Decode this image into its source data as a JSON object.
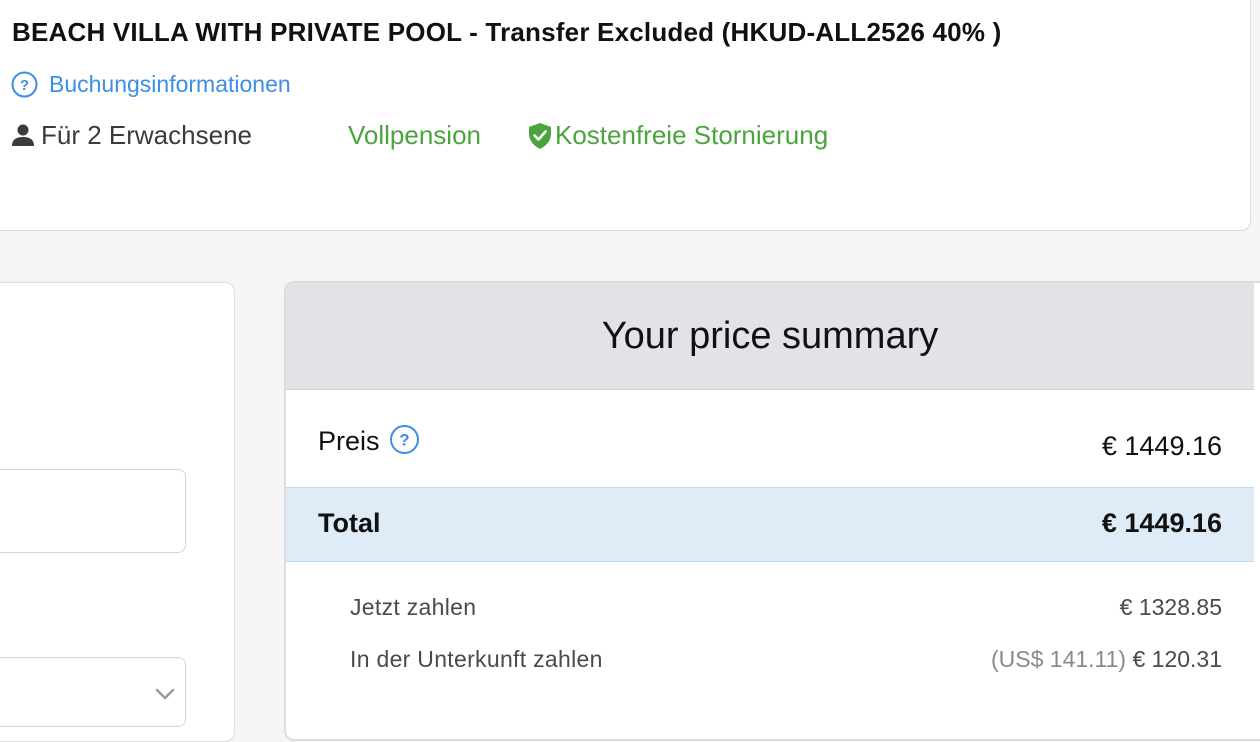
{
  "room": {
    "title": "BEACH VILLA WITH PRIVATE POOL - Transfer Excluded (HKUD-ALL2526 40% )",
    "booking_info_label": "Buchungsinformationen",
    "booking_info_icon": "question-circle-icon",
    "guests_icon": "person-icon",
    "guests": "Für 2 Erwachsene",
    "board": "Vollpension",
    "cancellation_icon": "shield-check-icon",
    "cancellation": "Kostenfreie Stornierung"
  },
  "price_summary": {
    "title": "Your price summary",
    "price_label": "Preis",
    "price_info_icon": "question-circle-icon",
    "price_value": "€ 1449.16",
    "total_label": "Total",
    "total_value": "€ 1449.16",
    "pay_now_label": "Jetzt zahlen",
    "pay_now_value": "€ 1328.85",
    "pay_at_property_label": "In der Unterkunft zahlen",
    "pay_at_property_usd": "(US$ 141.11)",
    "pay_at_property_value": "€ 120.31"
  },
  "colors": {
    "link_blue": "#3d8ee6",
    "success_green": "#4ba43d",
    "header_gray": "#e1e3e7",
    "total_blue": "#dfebf6"
  }
}
